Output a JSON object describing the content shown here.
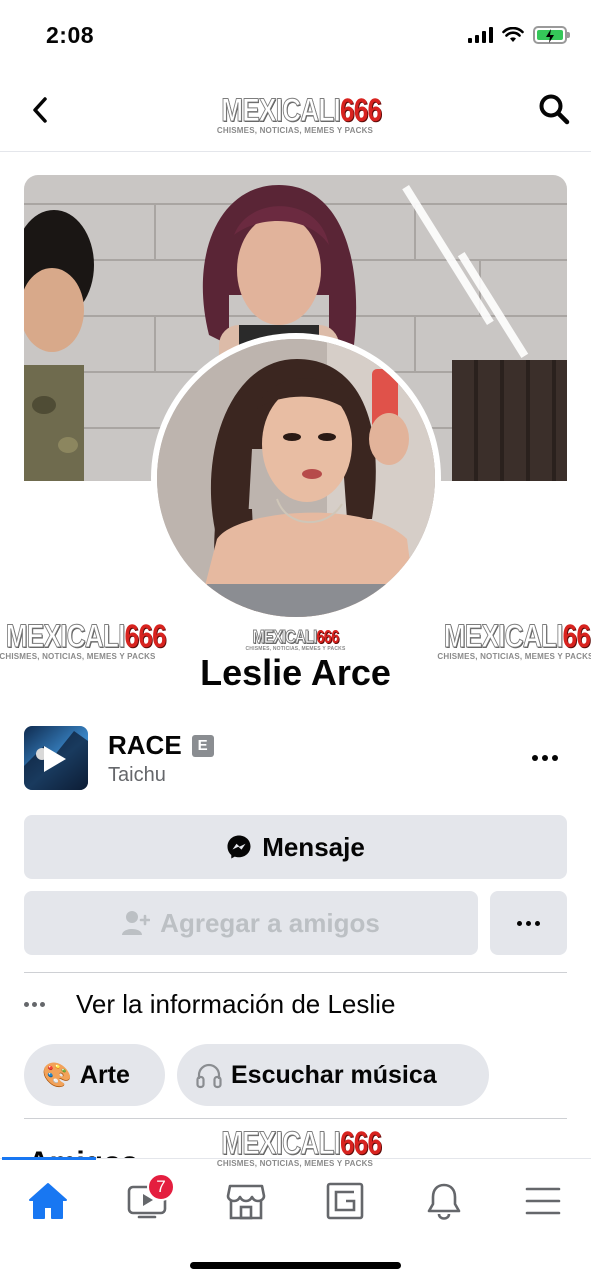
{
  "status_bar": {
    "time": "2:08"
  },
  "header": {
    "logo_main_1": "MEXICALI",
    "logo_main_2": "666",
    "logo_sub": "CHISMES, NOTICIAS, MEMES Y PACKS"
  },
  "profile": {
    "name": "Leslie Arce"
  },
  "music": {
    "title": "RACE",
    "explicit": "E",
    "artist": "Taichu"
  },
  "actions": {
    "message_label": "Mensaje",
    "add_friend_label": "Agregar a amigos"
  },
  "info": {
    "label": "Ver la información de Leslie"
  },
  "interests": [
    {
      "emoji": "🎨",
      "label": "Arte"
    },
    {
      "label": "Escuchar música"
    }
  ],
  "next_section": {
    "title": "Amigos"
  },
  "tabs": {
    "video_badge": "7"
  },
  "colors": {
    "accent": "#1877f2",
    "badge": "#e41e3f",
    "button_bg": "#e4e6eb"
  }
}
